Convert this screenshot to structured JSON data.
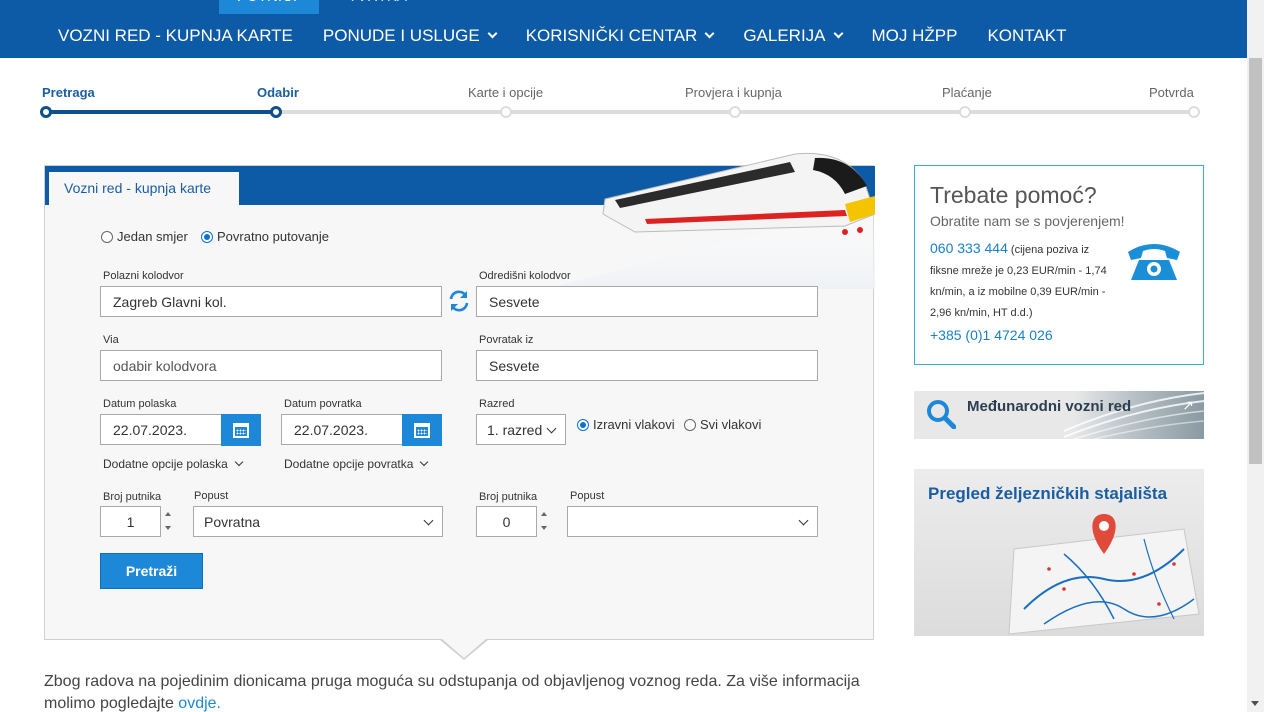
{
  "top_tabs": [
    "PUTNICI",
    "TVRTKA"
  ],
  "menu": [
    {
      "label": "VOZNI RED - KUPNJA KARTE",
      "dropdown": false
    },
    {
      "label": "PONUDE I USLUGE",
      "dropdown": true
    },
    {
      "label": "KORISNIČKI CENTAR",
      "dropdown": true
    },
    {
      "label": "GALERIJA",
      "dropdown": true
    },
    {
      "label": "MOJ HŽPP",
      "dropdown": false
    },
    {
      "label": "KONTAKT",
      "dropdown": false
    }
  ],
  "steps": [
    {
      "label": "Pretraga",
      "state": "done"
    },
    {
      "label": "Odabir",
      "state": "current"
    },
    {
      "label": "Karte i opcije",
      "state": "todo"
    },
    {
      "label": "Provjera i kupnja",
      "state": "todo"
    },
    {
      "label": "Plaćanje",
      "state": "todo"
    },
    {
      "label": "Potvrda",
      "state": "todo"
    }
  ],
  "panel": {
    "tab": "Vozni red - kupnja karte",
    "trip_type": {
      "one_way": "Jedan smjer",
      "return": "Povratno putovanje",
      "selected": "return"
    },
    "departure_label": "Polazni kolodvor",
    "departure_value": "Zagreb Glavni kol.",
    "destination_label": "Odredišni kolodvor",
    "destination_value": "Sesvete",
    "via_label": "Via",
    "via_placeholder": "odabir kolodvora",
    "return_from_label": "Povratak iz",
    "return_from_value": "Sesvete",
    "depart_date_label": "Datum polaska",
    "depart_date_value": "22.07.2023.",
    "return_date_label": "Datum povratka",
    "return_date_value": "22.07.2023.",
    "class_label": "Razred",
    "class_value": "1. razred",
    "train_type": {
      "direct": "Izravni vlakovi",
      "all": "Svi vlakovi",
      "selected": "direct"
    },
    "extra_depart": "Dodatne opcije polaska",
    "extra_return": "Dodatne opcije povratka",
    "passengers_label": "Broj putnika",
    "passengers_value": "1",
    "discount_label": "Popust",
    "discount_value": "Povratna",
    "passengers2_label": "Broj putnika",
    "passengers2_value": "0",
    "discount2_label": "Popust",
    "discount2_value": "",
    "search_button": "Pretraži"
  },
  "notice": {
    "text": "Zbog radova na pojedinim dionicama pruga moguća su odstupanja od objavljenog voznog reda. Za više informacija molimo pogledajte ",
    "link": "ovdje."
  },
  "help": {
    "title": "Trebate pomoć?",
    "subtitle": "Obratite nam se s povjerenjem!",
    "phone": "060 333 444",
    "phone_note": " (cijena poziva iz fiksne mreže je 0,23 EUR/min - 1,74 kn/min, a iz mobilne 0,39 EUR/min - 2,96 kn/min, HT d.d.)",
    "phone2": "+385 (0)1 4724 026"
  },
  "banner_international": "Međunarodni vozni red",
  "banner_stations": "Pregled željezničkih stajališta",
  "colors": {
    "nav": "#0d5aa7",
    "accent": "#1e88d8",
    "step_done": "#0d4f8f"
  }
}
